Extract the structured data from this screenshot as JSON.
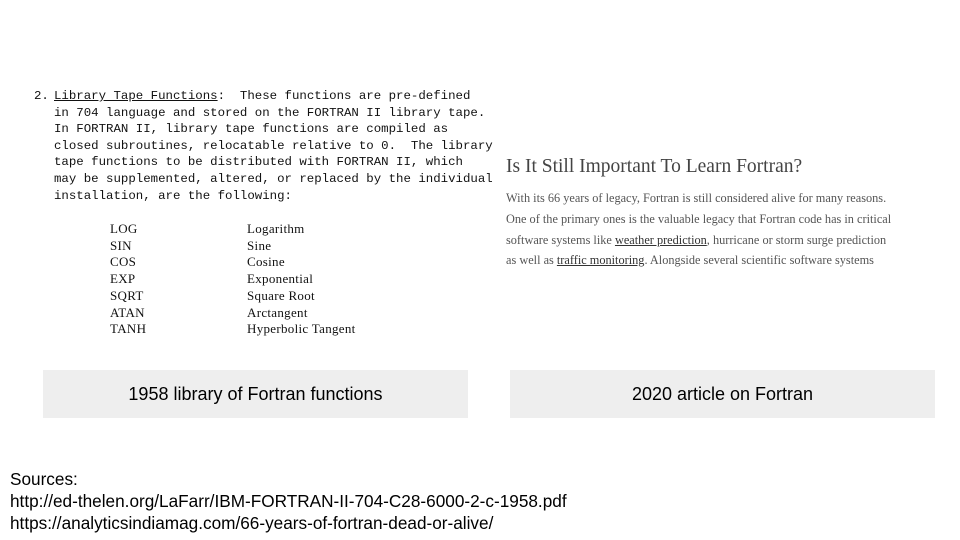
{
  "left_document": {
    "item_number": "2.",
    "heading": "Library Tape Functions",
    "heading_suffix": ":  These functions are pre-defined",
    "lines": [
      "in 704 language and stored on the FORTRAN II library tape.",
      "In FORTRAN II, library tape functions are compiled as",
      "closed subroutines, relocatable relative to 0.  The library",
      "tape functions to be distributed with FORTRAN II, which",
      "may be supplemented, altered, or replaced by the individual",
      "installation, are the following:"
    ],
    "functions": [
      {
        "name": "LOG",
        "desc": "Logarithm"
      },
      {
        "name": "SIN",
        "desc": "Sine"
      },
      {
        "name": "COS",
        "desc": "Cosine"
      },
      {
        "name": "EXP",
        "desc": "Exponential"
      },
      {
        "name": "SQRT",
        "desc": "Square Root"
      },
      {
        "name": "ATAN",
        "desc": "Arctangent"
      },
      {
        "name": "TANH",
        "desc": "Hyperbolic Tangent"
      }
    ]
  },
  "right_article": {
    "title": "Is It Still Important To Learn Fortran?",
    "line1": "With its 66 years of legacy, Fortran is still considered alive for many reasons.",
    "line2": "One of the primary ones is the valuable legacy that Fortran code has in critical",
    "line3_before": "software systems like ",
    "line3_link": "weather prediction",
    "line3_after": ", hurricane or storm surge prediction",
    "line4_before": "as well as ",
    "line4_link": "traffic monitoring",
    "line4_after": ". Alongside several scientific software systems"
  },
  "captions": {
    "left": "1958 library of Fortran functions",
    "right": "2020 article on Fortran"
  },
  "sources": {
    "label": "Sources:",
    "url1": "http://ed-thelen.org/LaFarr/IBM-FORTRAN-II-704-C28-6000-2-c-1958.pdf",
    "url2": "https://analyticsindiamag.com/66-years-of-fortran-dead-or-alive/"
  }
}
